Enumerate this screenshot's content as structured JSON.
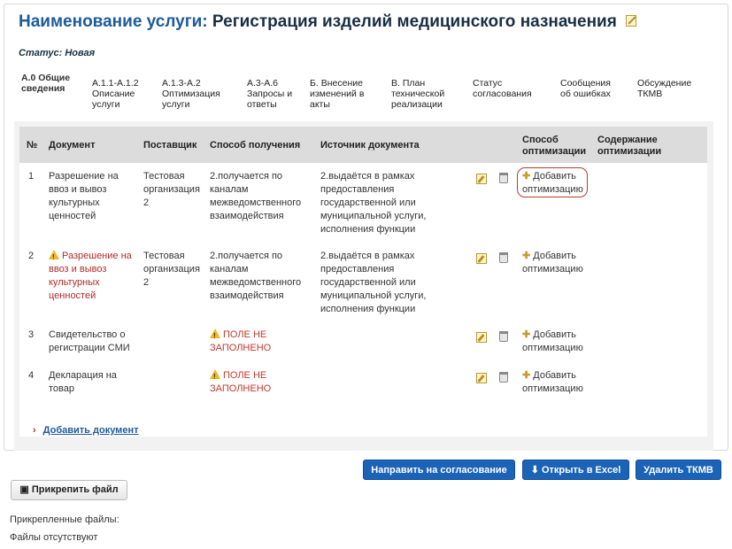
{
  "header": {
    "title_key": "Наименование услуги:",
    "title_value": "Регистрация изделий медицинского назначения"
  },
  "status": {
    "label": "Статус:",
    "value": "Новая"
  },
  "tabs": [
    {
      "label": "А.0 Общие сведения"
    },
    {
      "label": "А.1.1-А.1.2 Описание услуги"
    },
    {
      "label": "А.1.3-А.2 Оптимизация услуги"
    },
    {
      "label": "А.3-А.6 Запросы и ответы"
    },
    {
      "label": "Б. Внесение изменений в акты"
    },
    {
      "label": "В. План технической реализации"
    },
    {
      "label": "Статус согласования"
    },
    {
      "label": "Сообщения об ошибках"
    },
    {
      "label": "Обсуждение ТКМВ"
    }
  ],
  "table": {
    "headers": {
      "num": "№",
      "document": "Документ",
      "supplier": "Поставщик",
      "method": "Способ получения",
      "source": "Источник документа",
      "opt_method": "Способ оптимизации",
      "opt_content": "Содержание оптимизации"
    },
    "rows": [
      {
        "num": "1",
        "document": "Разрешение на ввоз и вывоз культурных ценностей",
        "supplier": "Тестовая организация 2",
        "method": "2.получается по каналам межведомственного взаимодействия",
        "source": "2.выдаётся в рамках предоставления государственной или муниципальной услуги, исполнения функции",
        "action": "Добавить оптимизацию"
      },
      {
        "num": "2",
        "document": "Разрешение на ввоз и вывоз культурных ценностей",
        "supplier": "Тестовая организация 2",
        "method": "2.получается по каналам межведомственного взаимодействия",
        "source": "2.выдаётся в рамках предоставления государственной или муниципальной услуги, исполнения функции",
        "action": "Добавить оптимизацию"
      },
      {
        "num": "3",
        "document": "Свидетельство о регистрации СМИ",
        "supplier": "",
        "method": "ПОЛЕ НЕ ЗАПОЛНЕНО",
        "source": "",
        "action": "Добавить оптимизацию"
      },
      {
        "num": "4",
        "document": "Декларация на товар",
        "supplier": "",
        "method": "ПОЛЕ НЕ ЗАПОЛНЕНО",
        "source": "",
        "action": "Добавить оптимизацию"
      }
    ]
  },
  "add_document": "Добавить документ",
  "buttons": {
    "send": "Направить на согласование",
    "excel": "Открыть в Excel",
    "delete": "Удалить ТКМВ",
    "attach": "Прикрепить файл"
  },
  "footer": {
    "attached_label": "Прикрепленные файлы:",
    "no_files": "Файлы отсутствуют"
  },
  "colors": {
    "primary_button": "#1a63b8",
    "title": "#1d5b9a",
    "warning": "#b22a2a"
  }
}
